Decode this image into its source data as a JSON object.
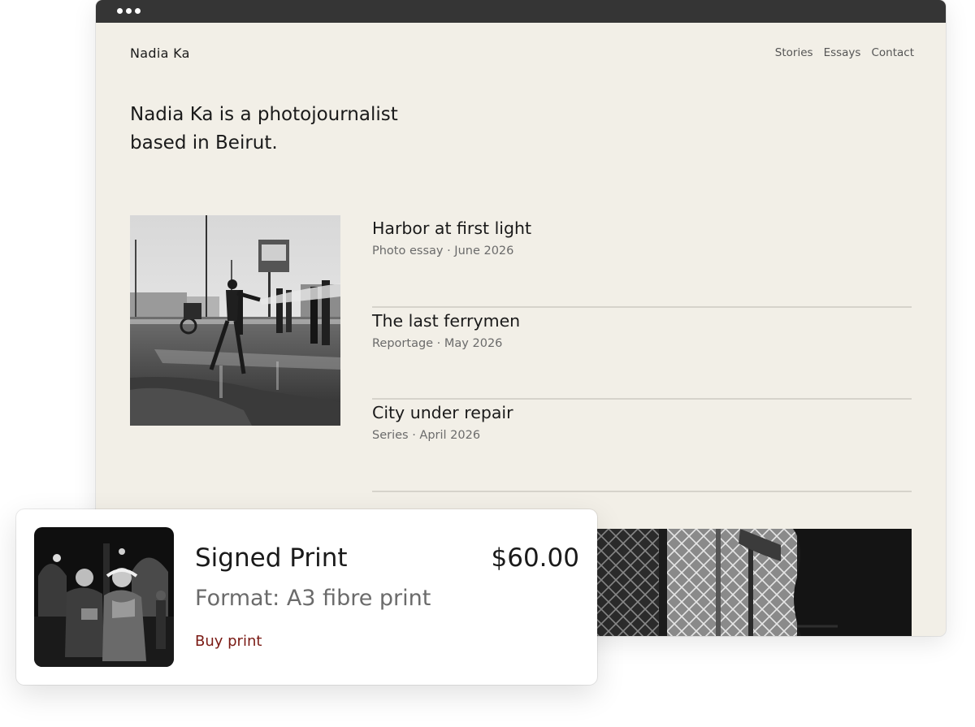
{
  "site": {
    "brand": "Nadia Ka",
    "nav": [
      "Stories",
      "Essays",
      "Contact"
    ],
    "intro": "Nadia Ka is a photojournalist based in Beirut."
  },
  "stories": [
    {
      "title": "Harbor at first light",
      "meta": "Photo essay · June 2026"
    },
    {
      "title": "The last ferrymen",
      "meta": "Reportage · May 2026"
    },
    {
      "title": "City under repair",
      "meta": "Series · April 2026"
    }
  ],
  "product": {
    "title": "Signed Print",
    "price": "$60.00",
    "format": "Format: A3 fibre print",
    "cta": "Buy print"
  },
  "colors": {
    "page_background": "#f2efe7",
    "titlebar": "#353535",
    "accent_link": "#7a1a14"
  }
}
